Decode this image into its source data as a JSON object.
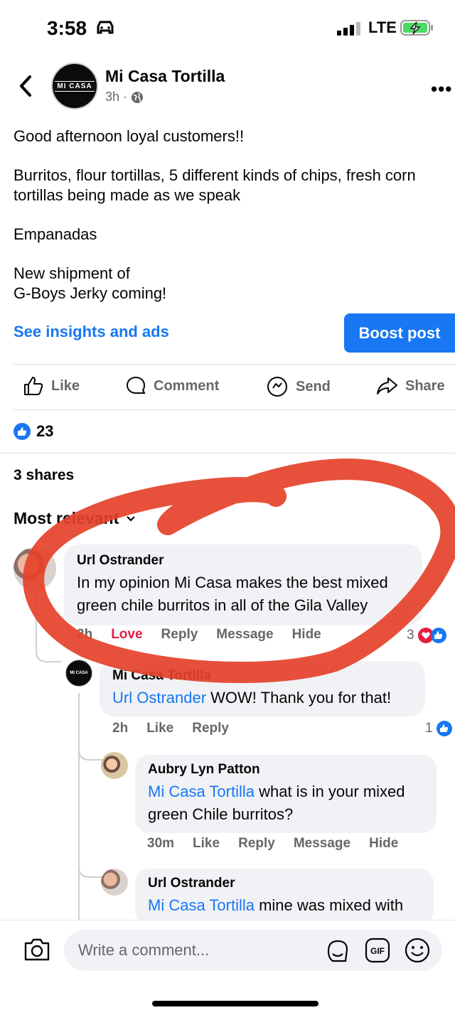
{
  "status_bar": {
    "time": "3:58",
    "network": "LTE"
  },
  "post": {
    "page_name": "Mi Casa Tortilla",
    "time_ago": "3h",
    "avatar_text": "MI CASA",
    "paragraphs": [
      "Good afternoon loyal customers!!",
      "Burritos, flour tortillas, 5 different kinds of chips, fresh corn tortillas being made as we speak",
      "Empanadas",
      "New shipment of\nG-Boys Jerky coming!"
    ],
    "insights_link": "See insights and ads",
    "boost_label": "Boost post",
    "actions": {
      "like": "Like",
      "comment": "Comment",
      "send": "Send",
      "share": "Share"
    },
    "reaction_count": "23",
    "shares": "3 shares",
    "sort_label": "Most relevant"
  },
  "comments": [
    {
      "author": "Url Ostrander",
      "text": "In my opinion Mi Casa makes the best mixed green chile burritos in all of the Gila Valley",
      "time": "2h",
      "actions": [
        "Love",
        "Reply",
        "Message",
        "Hide"
      ],
      "reactions": "3"
    },
    {
      "author": "Mi Casa Tortilla",
      "mention": "Url Ostrander",
      "text": " WOW! Thank you for that!",
      "time": "2h",
      "actions": [
        "Like",
        "Reply"
      ],
      "reactions": "1"
    },
    {
      "author": "Aubry Lyn Patton",
      "mention": "Mi Casa Tortilla",
      "text": " what is in your mixed green Chile burritos?",
      "time": "30m",
      "actions": [
        "Like",
        "Reply",
        "Message",
        "Hide"
      ]
    },
    {
      "author": "Url Ostrander",
      "mention": "Mi Casa Tortilla",
      "text": " mine was mixed with"
    }
  ],
  "composer": {
    "placeholder": "Write a comment..."
  },
  "colors": {
    "accent": "#1877f2",
    "love": "#e41e3f",
    "annotation": "#e5412a"
  }
}
